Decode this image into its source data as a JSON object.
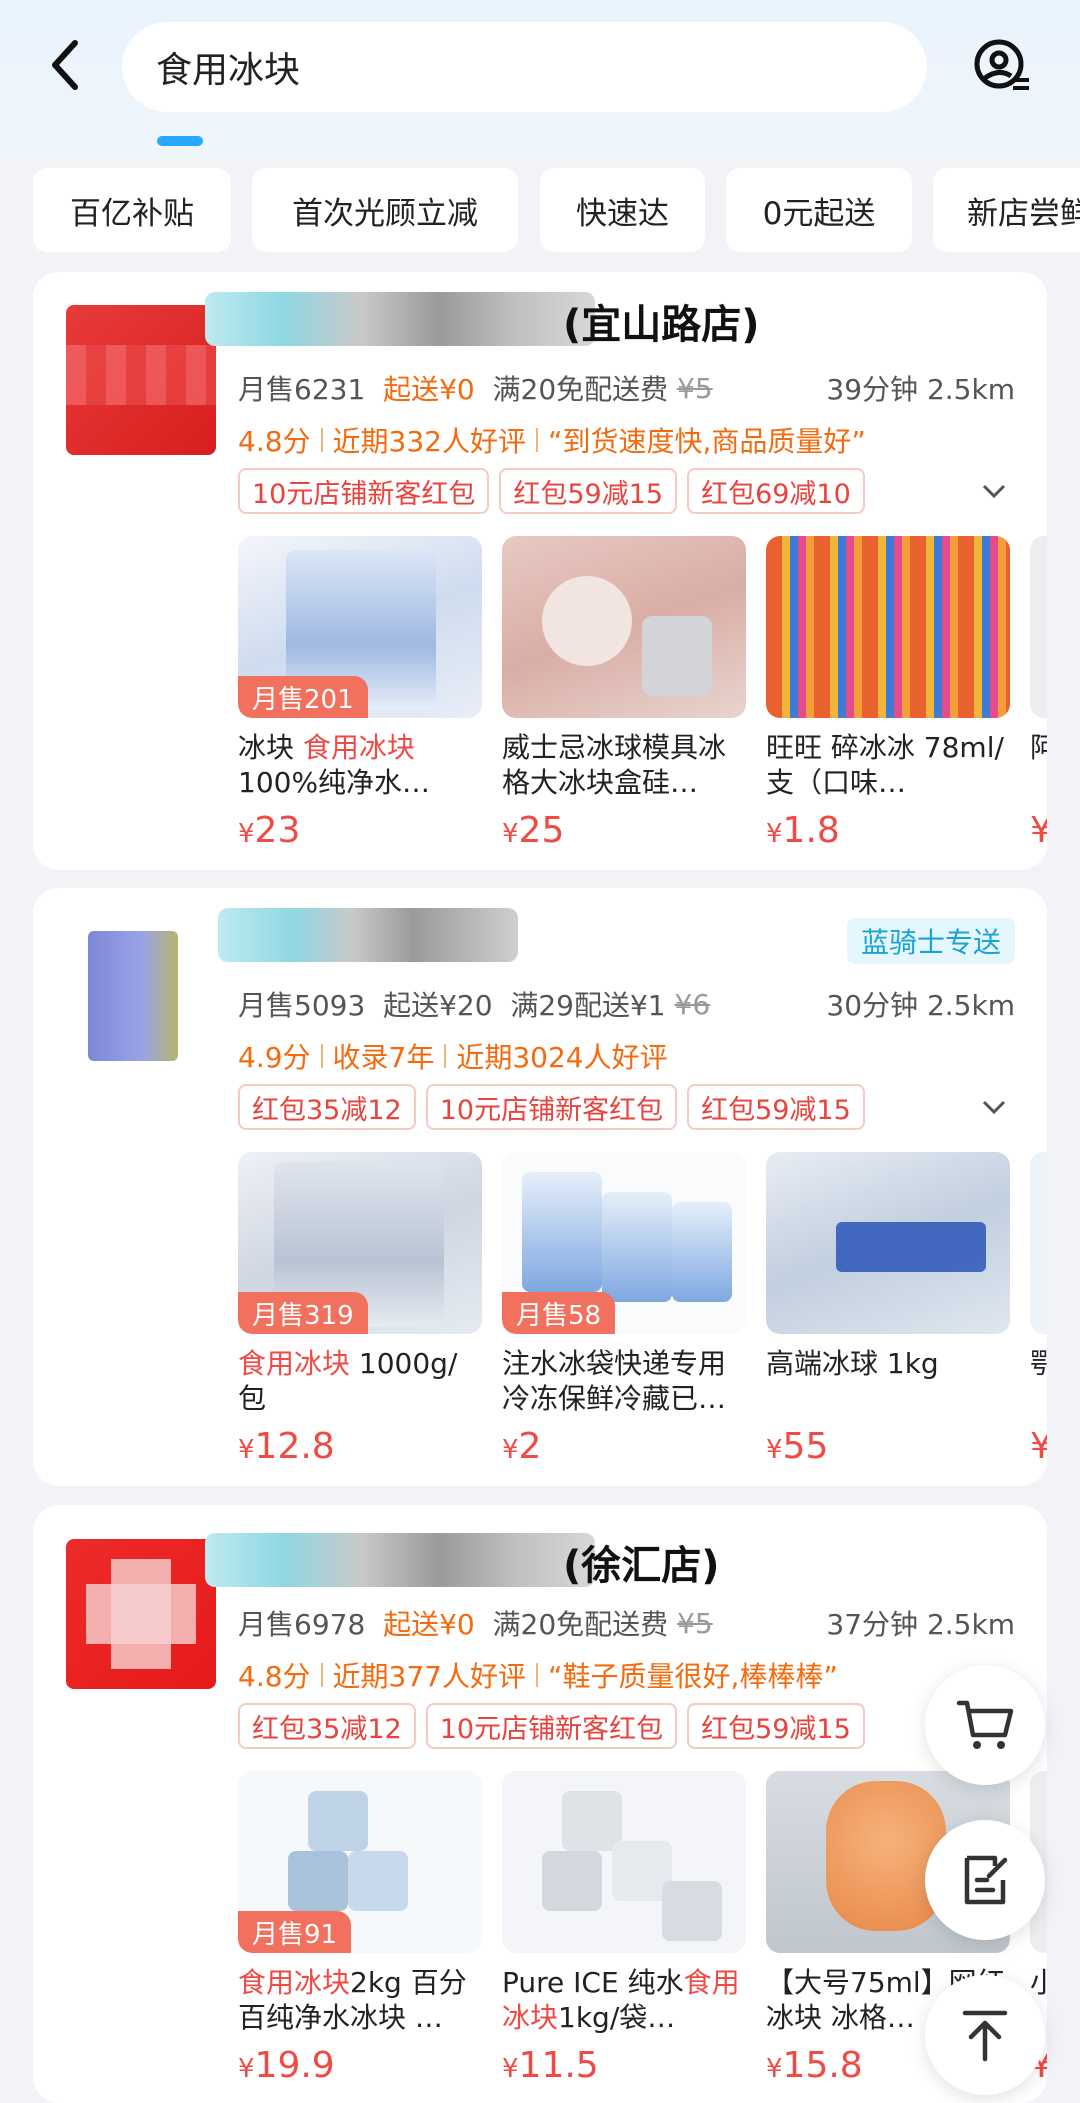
{
  "search": {
    "query": "食用冰块"
  },
  "filters": [
    "百亿补贴",
    "首次光顾立减",
    "快速达",
    "0元起送",
    "新店尝鲜"
  ],
  "stores": [
    {
      "name_suffix": "(宜山路店)",
      "monthly_sales": "月售6231",
      "min_order": "起送¥0",
      "delivery": "满20免配送费",
      "delivery_orig": "¥5",
      "time": "39分钟",
      "distance": "2.5km",
      "rating": "4.8分",
      "reviews": "近期332人好评",
      "quote": "“到货速度快,商品质量好”",
      "coupons": [
        "10元店铺新客红包",
        "红包59减15",
        "红包69减10"
      ],
      "products": [
        {
          "badge": "月售201",
          "name_plain": "冰块 ",
          "name_hl": "食用冰块",
          "name_rest": " 100%纯净水…",
          "price": "23"
        },
        {
          "badge": "",
          "name_plain": "威士忌冰球模具冰格大冰块盒硅…",
          "name_hl": "",
          "name_rest": "",
          "price": "25"
        },
        {
          "badge": "",
          "name_plain": "旺旺 碎冰冰 78ml/支（口味…",
          "name_hl": "",
          "name_rest": "",
          "price": "1.8"
        }
      ],
      "peek": {
        "name": "阿 吃",
        "price": "¥"
      }
    },
    {
      "name_suffix": "",
      "rider": "蓝骑士专送",
      "monthly_sales": "月售5093",
      "min_order": "起送¥20",
      "delivery": "满29配送¥1",
      "delivery_orig": "¥6",
      "time": "30分钟",
      "distance": "2.5km",
      "rating": "4.9分",
      "years": "收录7年",
      "reviews": "近期3024人好评",
      "coupons": [
        "红包35减12",
        "10元店铺新客红包",
        "红包59减15"
      ],
      "products": [
        {
          "badge": "月售319",
          "name_plain": "",
          "name_hl": "食用冰块",
          "name_rest": "  1000g/包",
          "price": "12.8"
        },
        {
          "badge": "月售58",
          "name_plain": "注水冰袋快递专用冷冻保鲜冷藏已…",
          "name_hl": "",
          "name_rest": "",
          "price": "2"
        },
        {
          "badge": "",
          "name_plain": "高端冰球 1kg",
          "name_hl": "",
          "name_rest": "",
          "price": "55"
        }
      ],
      "peek": {
        "name": "鄂 前",
        "price": "¥"
      }
    },
    {
      "name_suffix": "(徐汇店)",
      "monthly_sales": "月售6978",
      "min_order": "起送¥0",
      "delivery": "满20免配送费",
      "delivery_orig": "¥5",
      "time": "37分钟",
      "distance": "2.5km",
      "rating": "4.8分",
      "reviews": "近期377人好评",
      "quote": "“鞋子质量很好,棒棒棒”",
      "coupons": [
        "红包35减12",
        "10元店铺新客红包",
        "红包59减15"
      ],
      "products": [
        {
          "badge": "月售91",
          "name_plain": "",
          "name_hl": "食用冰块",
          "name_rest": "2kg 百分百纯净水冰块 …",
          "price": "19.9"
        },
        {
          "badge": "",
          "name_plain": "Pure ICE 纯水",
          "name_hl": "食用冰块",
          "name_rest": "1kg/袋…",
          "price": "11.5"
        },
        {
          "badge": "",
          "name_plain": "【大号75ml】网红冰块 冰格…",
          "name_hl": "",
          "name_rest": "",
          "price": "15.8"
        }
      ],
      "peek": {
        "name": "小 早",
        "price": "¥"
      }
    }
  ],
  "currency": "¥",
  "icons": {
    "back": "chevron-left-icon",
    "scan": "scan-icon",
    "cart": "cart-icon",
    "order": "order-icon",
    "top": "arrow-up-icon"
  },
  "colors": {
    "accent": "#f04a45",
    "orange": "#f36b0e",
    "blue": "#2aa7ff"
  }
}
